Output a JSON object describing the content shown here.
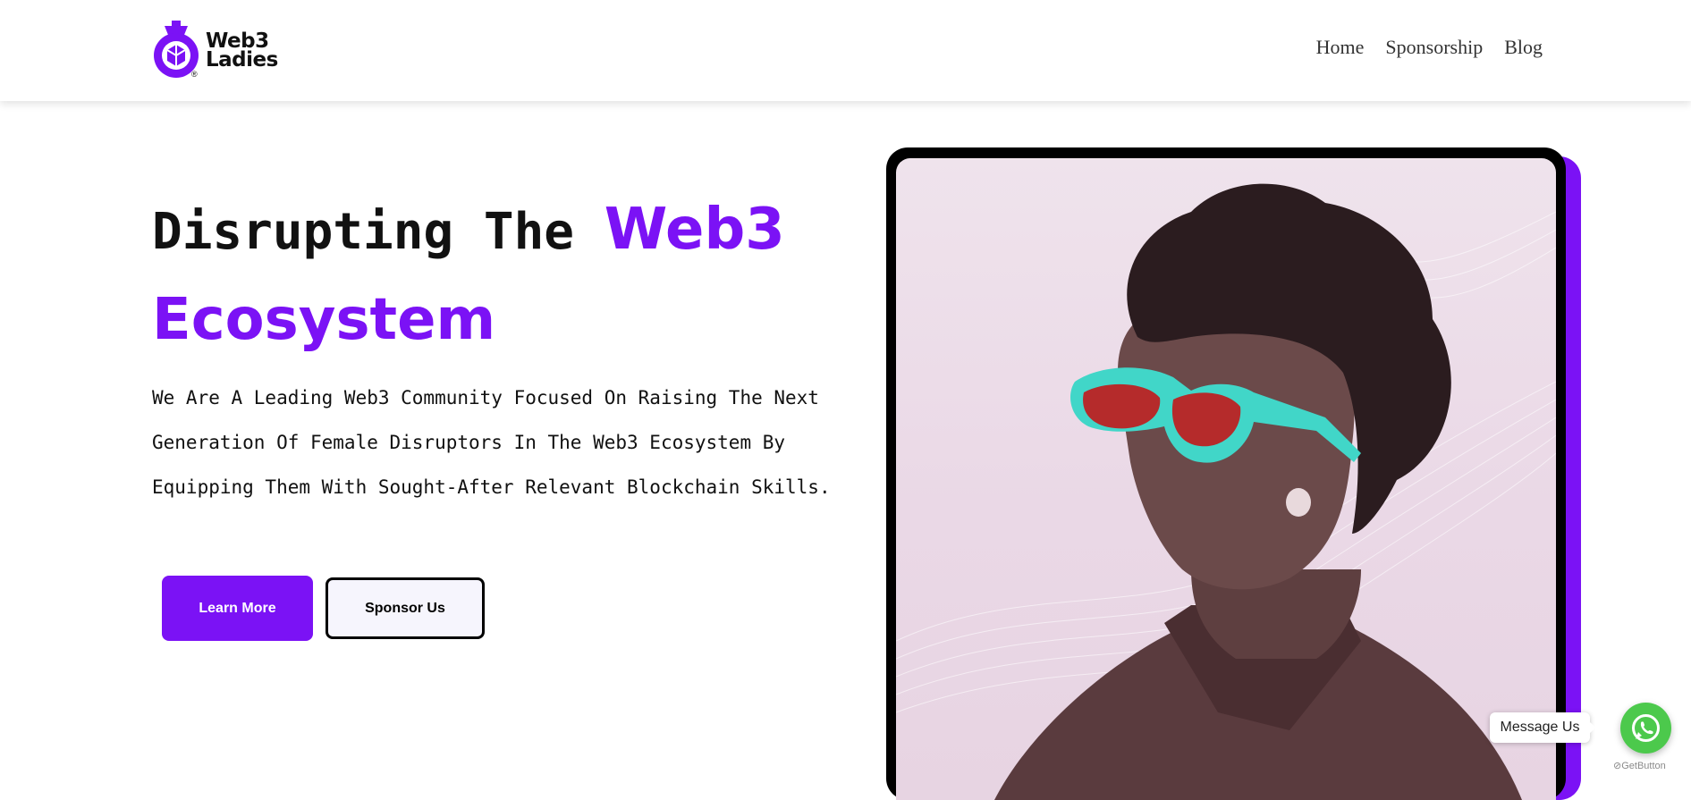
{
  "brand": {
    "name_line1": "Web3",
    "name_line2": "Ladies",
    "registered": "®",
    "color": "#7b12f5"
  },
  "nav": {
    "items": [
      {
        "label": "Home"
      },
      {
        "label": "Sponsorship"
      },
      {
        "label": "Blog"
      }
    ]
  },
  "hero": {
    "title_plain": "Disrupting The ",
    "title_accent_1": "Web3",
    "title_accent_2": "Ecosystem",
    "description": "We Are A Leading Web3 Community Focused On Raising The Next Generation Of Female Disruptors In The Web3 Ecosystem By Equipping Them With Sought-After Relevant Blockchain Skills.",
    "primary_button": "Learn More",
    "secondary_button": "Sponsor Us",
    "image_icon": "woman-with-sunglasses-photo"
  },
  "chat": {
    "label": "Message Us",
    "icon": "whatsapp-icon",
    "powered_by": "GetButton",
    "color": "#4cc94c"
  },
  "colors": {
    "accent": "#7b12f5",
    "text": "#111111",
    "nav_text": "#333333"
  }
}
